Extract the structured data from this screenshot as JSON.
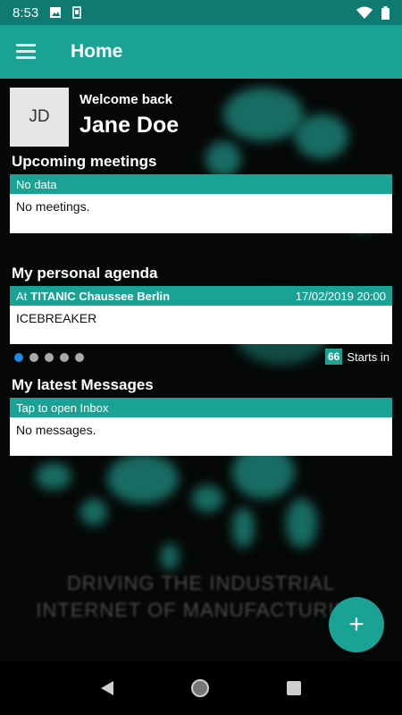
{
  "status_bar": {
    "time": "8:53",
    "icons": [
      "image-icon",
      "sim-icon",
      "wifi-icon",
      "battery-icon"
    ]
  },
  "app_bar": {
    "title": "Home",
    "menu_icon": "menu-icon"
  },
  "profile": {
    "initials": "JD",
    "welcome": "Welcome back",
    "name": "Jane Doe"
  },
  "meetings": {
    "title": "Upcoming meetings",
    "header": "No data",
    "body": "No meetings."
  },
  "agenda": {
    "title": "My personal agenda",
    "at_label": "At",
    "location": "TITANIC Chaussee Berlin",
    "datetime": "17/02/2019 20:00",
    "event": "ICEBREAKER",
    "pager": {
      "count": 5,
      "active": 0
    },
    "starts_count": "66",
    "starts_label": "Starts in"
  },
  "messages": {
    "title": "My latest Messages",
    "header": "Tap to open Inbox",
    "body": "No messages."
  },
  "background": {
    "line1": "DRIVING THE INDUSTRIAL",
    "line2": "INTERNET OF MANUFACTURING"
  },
  "fab": {
    "label": "+"
  },
  "colors": {
    "accent": "#1aa394",
    "status": "#0f7a70"
  }
}
